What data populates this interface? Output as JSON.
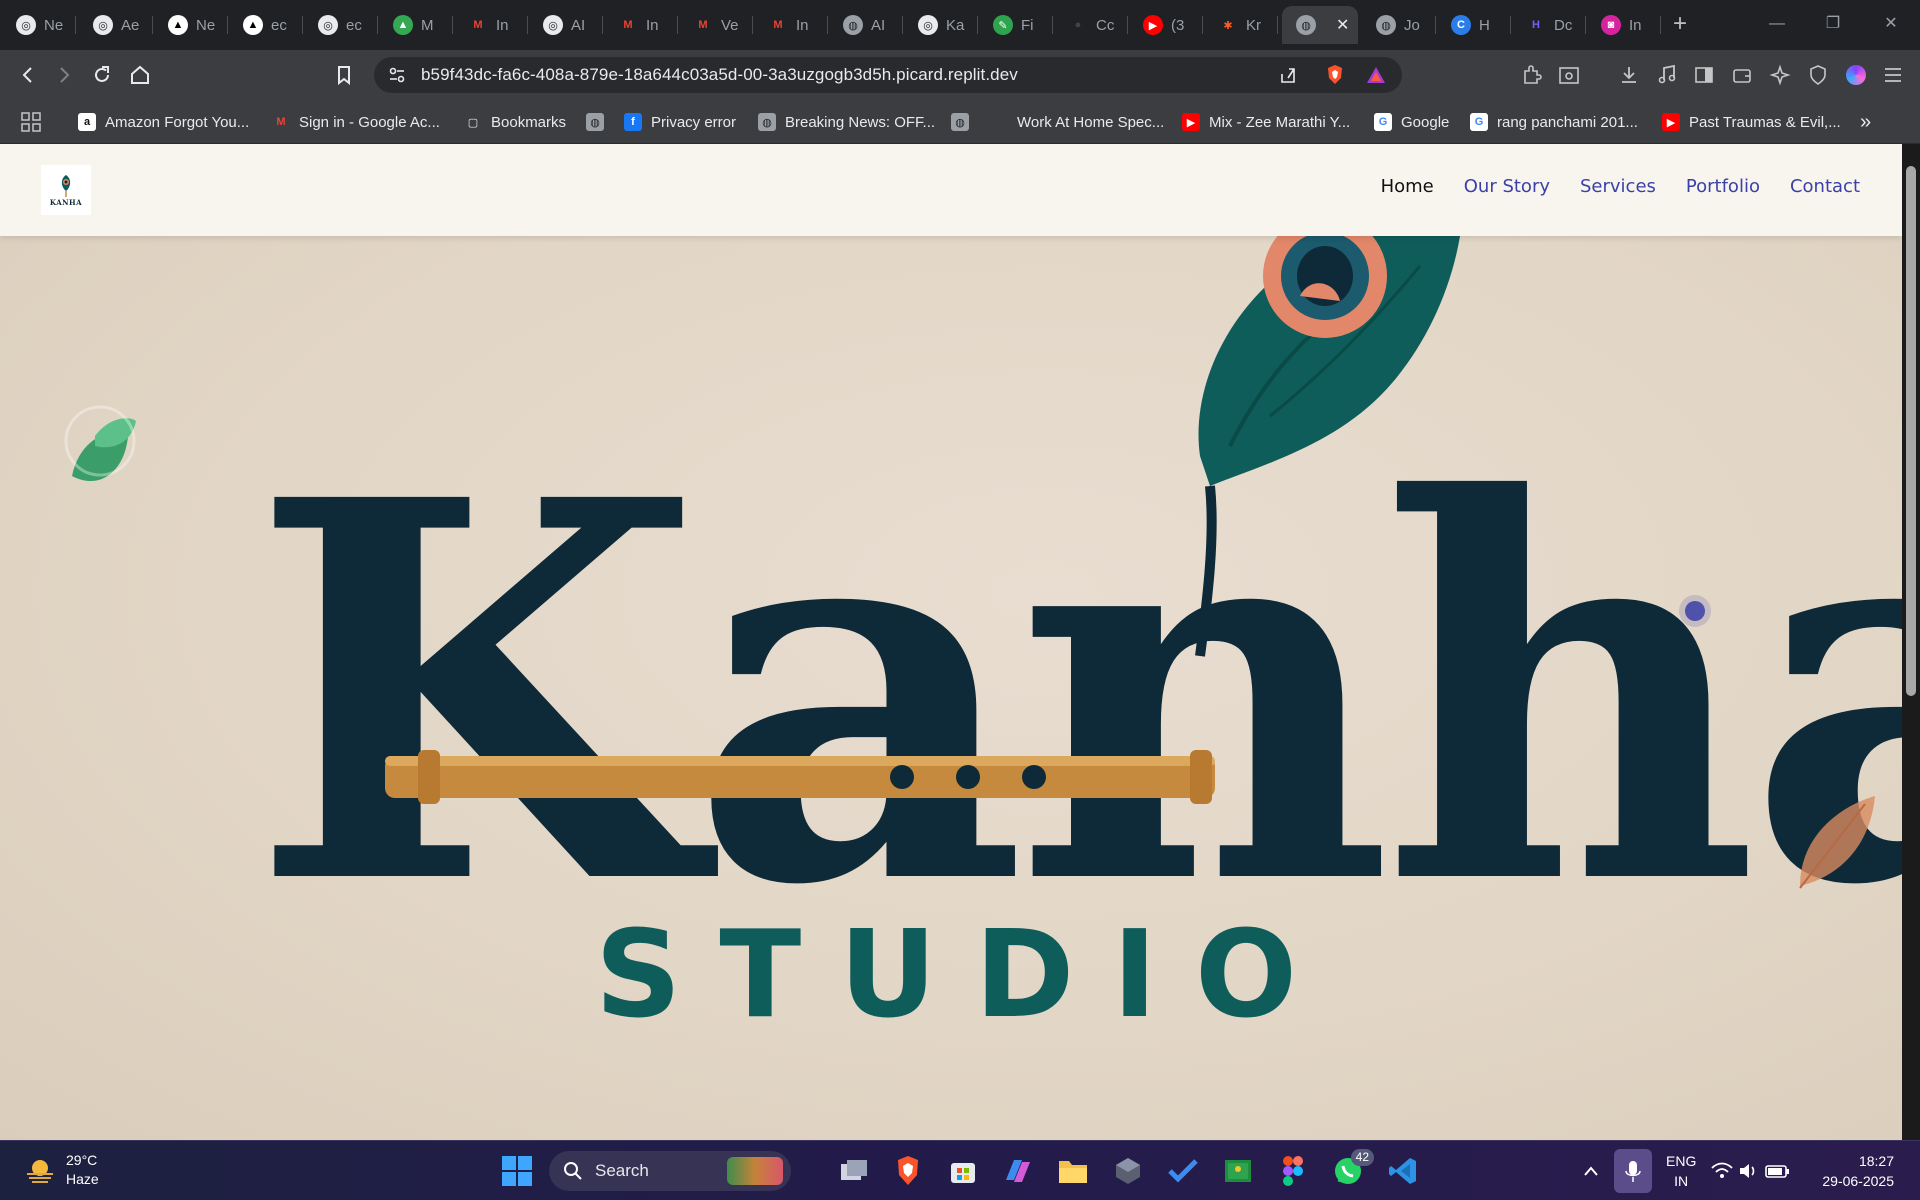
{
  "browser": {
    "tabs": [
      {
        "label": "Ne",
        "icon": "openai-icon"
      },
      {
        "label": "Ae",
        "icon": "openai-icon"
      },
      {
        "label": "Ne",
        "icon": "vercel-icon"
      },
      {
        "label": "ec",
        "icon": "vercel-icon"
      },
      {
        "label": "ec",
        "icon": "openai-icon"
      },
      {
        "label": "M",
        "icon": "drive-icon"
      },
      {
        "label": "In",
        "icon": "gmail-icon"
      },
      {
        "label": "AI",
        "icon": "openai-icon"
      },
      {
        "label": "In",
        "icon": "gmail-icon"
      },
      {
        "label": "Ve",
        "icon": "gmail-icon"
      },
      {
        "label": "In",
        "icon": "gmail-icon"
      },
      {
        "label": "AI",
        "icon": "globe-icon"
      },
      {
        "label": "Ka",
        "icon": "openai-icon"
      },
      {
        "label": "Fi",
        "icon": "edit-icon"
      },
      {
        "label": "Cc",
        "icon": "github-icon"
      },
      {
        "label": "(3",
        "icon": "youtube-icon"
      },
      {
        "label": "Kr",
        "icon": "figma-icon"
      },
      {
        "label": "",
        "icon": "globe-icon",
        "active": true
      },
      {
        "label": "Jo",
        "icon": "globe-icon"
      },
      {
        "label": "H",
        "icon": "c-icon"
      },
      {
        "label": "Dc",
        "icon": "d-icon"
      },
      {
        "label": "In",
        "icon": "instagram-icon"
      }
    ],
    "url": "b59f43dc-fa6c-408a-879e-18a644c03a5d-00-3a3uzgogb3d5h.picard.replit.dev",
    "bookmarks": [
      {
        "label": "Amazon Forgot You...",
        "icon": "amazon-icon"
      },
      {
        "label": "Sign in - Google Ac...",
        "icon": "gmail-icon"
      },
      {
        "label": "Bookmarks",
        "icon": "bookmark-folder-icon"
      },
      {
        "label": "",
        "icon": "globe-icon"
      },
      {
        "label": "Privacy error",
        "icon": "facebook-icon"
      },
      {
        "label": "Breaking News: OFF...",
        "icon": "globe-icon"
      },
      {
        "label": "",
        "icon": "globe-icon"
      },
      {
        "label": "Work At Home Spec...",
        "icon": ""
      },
      {
        "label": "Mix - Zee Marathi Y...",
        "icon": "youtube-icon"
      },
      {
        "label": "Google",
        "icon": "google-icon"
      },
      {
        "label": "rang panchami 201...",
        "icon": "google-icon"
      },
      {
        "label": "Past Traumas & Evil,...",
        "icon": "youtube-icon"
      }
    ],
    "more_bookmarks": "»"
  },
  "site": {
    "logo_text": "KANHA",
    "nav": [
      {
        "label": "Home",
        "active": true
      },
      {
        "label": "Our Story"
      },
      {
        "label": "Services"
      },
      {
        "label": "Portfolio"
      },
      {
        "label": "Contact"
      }
    ],
    "hero": {
      "brand": "Kanha",
      "subtitle": "STUDIO"
    },
    "colors": {
      "navy": "#0e2a38",
      "teal": "#0f5d5a",
      "gold": "#c58a3e",
      "nav_link": "#3b3fa8"
    }
  },
  "taskbar": {
    "weather_temp": "29°C",
    "weather_desc": "Haze",
    "search_placeholder": "Search",
    "whatsapp_badge": "42",
    "lang_top": "ENG",
    "lang_bottom": "IN",
    "time": "18:27",
    "date": "29-06-2025"
  }
}
